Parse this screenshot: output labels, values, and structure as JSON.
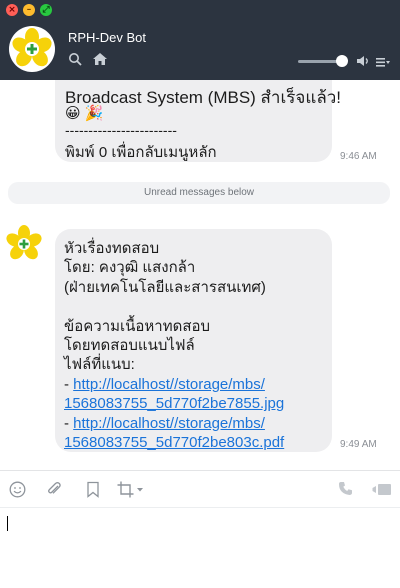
{
  "window": {
    "title": "RPH-Dev Bot",
    "controls": [
      "close",
      "minimize",
      "maximize"
    ]
  },
  "header": {
    "bot_name": "RPH-Dev Bot",
    "icons": [
      "search-icon",
      "home-icon",
      "volume-icon",
      "menu-icon"
    ]
  },
  "messages": [
    {
      "lines": [
        "Broadcast System (MBS) สำเร็จแล้ว!",
        "😀 🎉",
        "------------------------",
        "พิมพ์ 0 เพื่อกลับเมนูหลัก"
      ],
      "time": "9:46 AM"
    }
  ],
  "unread_banner": "Unread messages below",
  "message2": {
    "lines": [
      "หัวเรื่องทดสอบ",
      "โดย: คงวุฒิ แสงกล้า",
      "(ฝ่ายเทคโนโลยีและสารสนเทศ)",
      "",
      "ข้อความเนื้อหาทดสอบ",
      "โดยทดสอบแนบไฟล์",
      "ไฟล์ที่แนบ:"
    ],
    "attachments": [
      {
        "prefix": "- ",
        "line1": "http://localhost//storage/mbs/",
        "line2": "1568083755_5d770f2be7855.jpg"
      },
      {
        "prefix": "- ",
        "line1": "http://localhost//storage/mbs/",
        "line2": "1568083755_5d770f2be803c.pdf"
      }
    ],
    "time": "9:49 AM"
  },
  "composer": {
    "icons": [
      "emoji-icon",
      "attach-icon",
      "bookmark-icon",
      "crop-icon",
      "call-icon",
      "video-icon"
    ],
    "value": ""
  },
  "colors": {
    "header_bg": "#2c3440",
    "bubble_bg": "#eeeef0",
    "link": "#1a73d9",
    "logo_yellow": "#f6d20a"
  }
}
